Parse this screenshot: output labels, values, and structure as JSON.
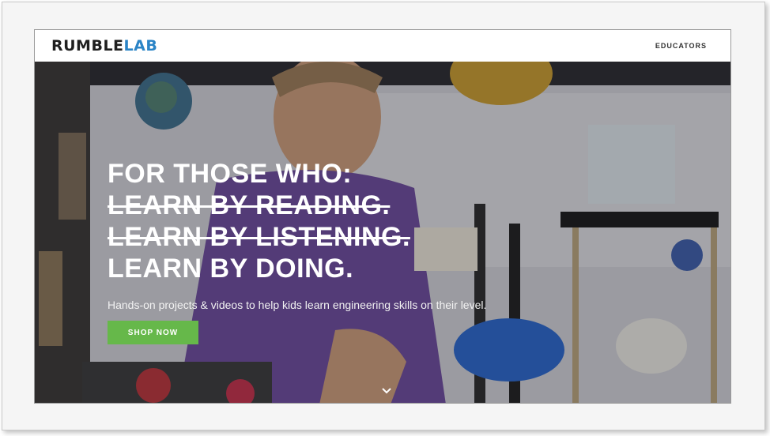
{
  "header": {
    "logo_part1": "RUMBLE",
    "logo_part2": "LAB",
    "nav_educators": "EDUCATORS"
  },
  "hero": {
    "line1": "FOR THOSE WHO:",
    "line2": "LEARN BY READING.",
    "line3": "LEARN BY LISTENING.",
    "line4": "LEARN BY DOING.",
    "subtitle": "Hands-on projects & videos to help kids learn engineering skills on their level.",
    "cta_label": "SHOP NOW",
    "scroll_icon": "chevron-down-icon"
  },
  "colors": {
    "brand_blue": "#2b84c6",
    "cta_green": "#66b84a",
    "logo_dark": "#1f1f1f"
  }
}
